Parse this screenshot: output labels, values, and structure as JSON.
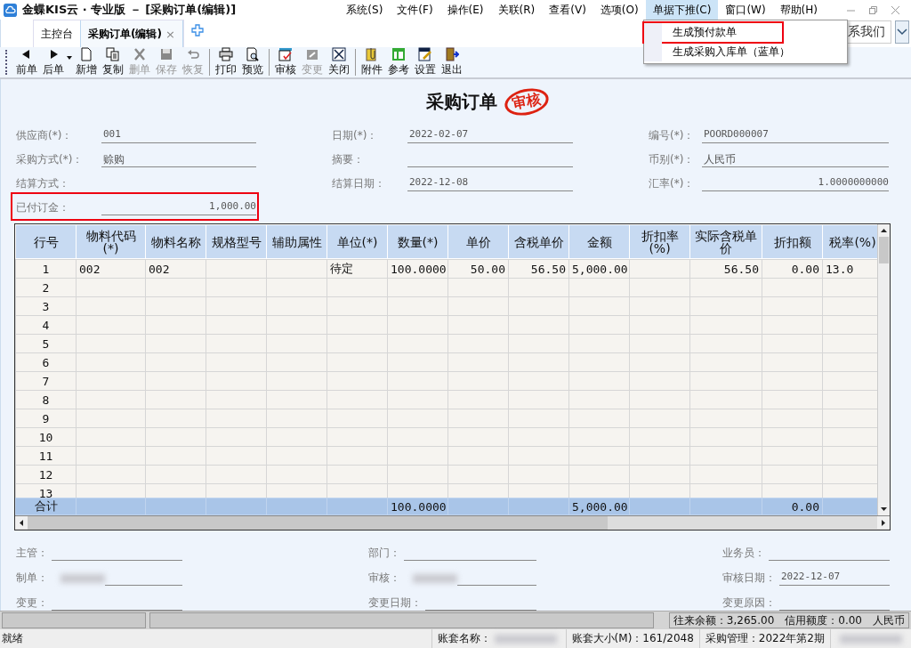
{
  "window": {
    "title": "金蝶KIS云 · 专业版 － [采购订单(编辑)]"
  },
  "menu": [
    {
      "label": "系统(S)",
      "selected": false
    },
    {
      "label": "文件(F)",
      "selected": false
    },
    {
      "label": "操作(E)",
      "selected": false
    },
    {
      "label": "关联(R)",
      "selected": false
    },
    {
      "label": "查看(V)",
      "selected": false
    },
    {
      "label": "选项(O)",
      "selected": false
    },
    {
      "label": "单据下推(C)",
      "selected": true
    },
    {
      "label": "窗口(W)",
      "selected": false
    },
    {
      "label": "帮助(H)",
      "selected": false
    }
  ],
  "dropdown": [
    {
      "label": "生成预付款单",
      "highlighted": true
    },
    {
      "label": "生成采购入库单（蓝单）",
      "highlighted": false
    }
  ],
  "tabs": [
    {
      "label": "主控台",
      "selected": false
    },
    {
      "label": "采购订单(编辑)",
      "selected": true,
      "close": "×"
    }
  ],
  "contact_button": "系我们",
  "toolbar": [
    {
      "buttons": [
        {
          "label": "前单",
          "disabled": false
        },
        {
          "label": "后单",
          "disabled": false,
          "dropdown": true
        },
        {
          "label": "新增",
          "disabled": false
        },
        {
          "label": "复制",
          "disabled": false
        },
        {
          "label": "删单",
          "disabled": true
        },
        {
          "label": "保存",
          "disabled": true
        },
        {
          "label": "恢复",
          "disabled": true
        }
      ]
    },
    {
      "buttons": [
        {
          "label": "打印",
          "disabled": false
        },
        {
          "label": "预览",
          "disabled": false
        }
      ]
    },
    {
      "buttons": [
        {
          "label": "审核",
          "disabled": false
        },
        {
          "label": "变更",
          "disabled": true
        },
        {
          "label": "关闭",
          "disabled": false
        }
      ]
    },
    {
      "buttons": [
        {
          "label": "附件",
          "disabled": false
        },
        {
          "label": "参考",
          "disabled": false
        },
        {
          "label": "设置",
          "disabled": false
        },
        {
          "label": "退出",
          "disabled": false
        }
      ]
    }
  ],
  "document": {
    "title": "采购订单",
    "stamp": "审核"
  },
  "header_fields": [
    {
      "label": "供应商(*)：",
      "value": "001",
      "kind": "text"
    },
    {
      "label": "日期(*)：",
      "value": "2022-02-07",
      "kind": "text"
    },
    {
      "label": "编号(*)：",
      "value": "POORD000007",
      "kind": "text"
    },
    {
      "label": "采购方式(*)：",
      "value": "赊购",
      "kind": "text"
    },
    {
      "label": "摘要：",
      "kind": "text"
    },
    {
      "label": "币别(*)：",
      "value": "人民币",
      "kind": "text"
    },
    {
      "label": "结算方式：",
      "kind": "plain"
    },
    {
      "label": "结算日期：",
      "value": "2022-12-08",
      "kind": "text"
    },
    {
      "label": "汇率(*)：",
      "value": "1.0000000000",
      "kind": "amount"
    },
    {
      "label": "已付订金：",
      "value": "1,000.00",
      "kind": "amount",
      "highlighted": true
    }
  ],
  "table": {
    "columns": [
      "行号",
      "物料代码(*)",
      "物料名称",
      "规格型号",
      "辅助属性",
      "单位(*)",
      "数量(*)",
      "单价",
      "含税单价",
      "金额",
      "折扣率(%)",
      "实际含税单价",
      "折扣额",
      "税率(%)"
    ],
    "rows": [
      {
        "cells": [
          "1",
          "002",
          "002",
          null,
          null,
          "待定",
          "100.0000",
          "50.00",
          "56.50",
          "5,000.00",
          null,
          "56.50",
          "0.00",
          "13.0"
        ]
      },
      {
        "cells": [
          "2"
        ]
      },
      {
        "cells": [
          "3"
        ]
      },
      {
        "cells": [
          "4"
        ]
      },
      {
        "cells": [
          "5"
        ]
      },
      {
        "cells": [
          "6"
        ]
      },
      {
        "cells": [
          "7"
        ]
      },
      {
        "cells": [
          "8"
        ]
      },
      {
        "cells": [
          "9"
        ]
      },
      {
        "cells": [
          "10"
        ]
      },
      {
        "cells": [
          "11"
        ]
      },
      {
        "cells": [
          "12"
        ]
      },
      {
        "cells": [
          "13"
        ]
      }
    ],
    "total": {
      "label": "合计",
      "quantity": "100.0000",
      "amount": "5,000.00",
      "discount": "0.00"
    }
  },
  "footer_fields": [
    {
      "label": "主管：",
      "kind": "text"
    },
    {
      "label": "部门：",
      "kind": "text"
    },
    {
      "label": "业务员：",
      "kind": "text"
    },
    {
      "label": "制单：",
      "kind": "blurred"
    },
    {
      "label": "审核：",
      "kind": "blurred"
    },
    {
      "label": "审核日期：",
      "value": "2022-12-07",
      "kind": "text"
    },
    {
      "label": "变更：",
      "kind": "text"
    },
    {
      "label": "变更日期：",
      "kind": "text"
    },
    {
      "label": "变更原因：",
      "kind": "text"
    }
  ],
  "balance_bar": [
    "往来余额：3,265.00",
    "信用额度：0.00",
    "人民币"
  ],
  "status_bar": [
    {
      "text": "就绪",
      "kind": "text"
    },
    {
      "text": "账套名称：",
      "kind": "blurred"
    },
    {
      "text": "账套大小(M)：161/2048",
      "kind": "text"
    },
    {
      "text": "采购管理：2022年第2期",
      "kind": "text"
    },
    {
      "kind": "blurred"
    }
  ]
}
